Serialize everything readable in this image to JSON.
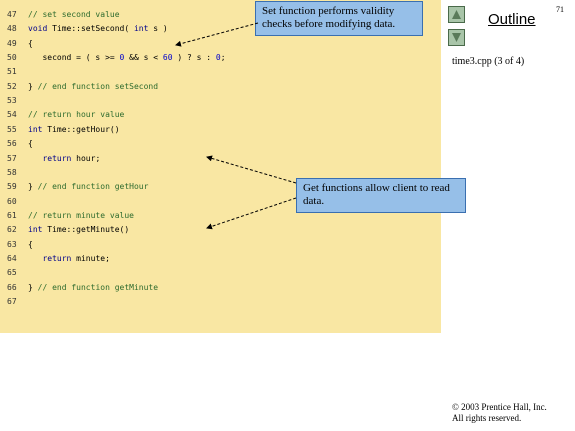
{
  "page_number": "71",
  "outline_label": "Outline",
  "file_caption": "time3.cpp (3 of 4)",
  "copyright": [
    "© 2003 Prentice Hall, Inc.",
    "All rights reserved."
  ],
  "nav": {
    "up_icon": "triangle-up-icon",
    "down_icon": "triangle-down-icon"
  },
  "colors": {
    "code_background": "#f9e7a3",
    "callout_background": "#96bfe8",
    "nav_button": "#a9c5a9"
  },
  "code_lines": [
    {
      "num": "47",
      "segments": [
        {
          "t": "// set second value",
          "c": "cm"
        }
      ]
    },
    {
      "num": "48",
      "segments": [
        {
          "t": "void",
          "c": "kw"
        },
        {
          "t": " Time::setSecond( ",
          "c": ""
        },
        {
          "t": "int",
          "c": "kw"
        },
        {
          "t": " s )",
          "c": ""
        }
      ]
    },
    {
      "num": "49",
      "segments": [
        {
          "t": "{",
          "c": ""
        }
      ]
    },
    {
      "num": "50",
      "segments": [
        {
          "t": "   second = ( s >= ",
          "c": ""
        },
        {
          "t": "0",
          "c": "num"
        },
        {
          "t": " && s < ",
          "c": ""
        },
        {
          "t": "60",
          "c": "num"
        },
        {
          "t": " ) ? s : ",
          "c": ""
        },
        {
          "t": "0",
          "c": "num"
        },
        {
          "t": ";",
          "c": ""
        }
      ]
    },
    {
      "num": "51",
      "segments": []
    },
    {
      "num": "52",
      "segments": [
        {
          "t": "} ",
          "c": ""
        },
        {
          "t": "// end function setSecond",
          "c": "cm"
        }
      ]
    },
    {
      "num": "53",
      "segments": []
    },
    {
      "num": "54",
      "segments": [
        {
          "t": "// return hour value",
          "c": "cm"
        }
      ]
    },
    {
      "num": "55",
      "segments": [
        {
          "t": "int",
          "c": "kw"
        },
        {
          "t": " Time::getHour()",
          "c": ""
        }
      ]
    },
    {
      "num": "56",
      "segments": [
        {
          "t": "{",
          "c": ""
        }
      ]
    },
    {
      "num": "57",
      "segments": [
        {
          "t": "   ",
          "c": ""
        },
        {
          "t": "return",
          "c": "kw"
        },
        {
          "t": " hour;",
          "c": ""
        }
      ]
    },
    {
      "num": "58",
      "segments": []
    },
    {
      "num": "59",
      "segments": [
        {
          "t": "} ",
          "c": ""
        },
        {
          "t": "// end function getHour",
          "c": "cm"
        }
      ]
    },
    {
      "num": "60",
      "segments": []
    },
    {
      "num": "61",
      "segments": [
        {
          "t": "// return minute value",
          "c": "cm"
        }
      ]
    },
    {
      "num": "62",
      "segments": [
        {
          "t": "int",
          "c": "kw"
        },
        {
          "t": " Time::getMinute()",
          "c": ""
        }
      ]
    },
    {
      "num": "63",
      "segments": [
        {
          "t": "{",
          "c": ""
        }
      ]
    },
    {
      "num": "64",
      "segments": [
        {
          "t": "   ",
          "c": ""
        },
        {
          "t": "return",
          "c": "kw"
        },
        {
          "t": " minute;",
          "c": ""
        }
      ]
    },
    {
      "num": "65",
      "segments": []
    },
    {
      "num": "66",
      "segments": [
        {
          "t": "} ",
          "c": ""
        },
        {
          "t": "// end function getMinute",
          "c": "cm"
        }
      ]
    },
    {
      "num": "67",
      "segments": []
    }
  ],
  "callouts": {
    "set_function": "Set function performs validity checks before modifying data.",
    "get_functions": "Get functions allow client to read data."
  }
}
